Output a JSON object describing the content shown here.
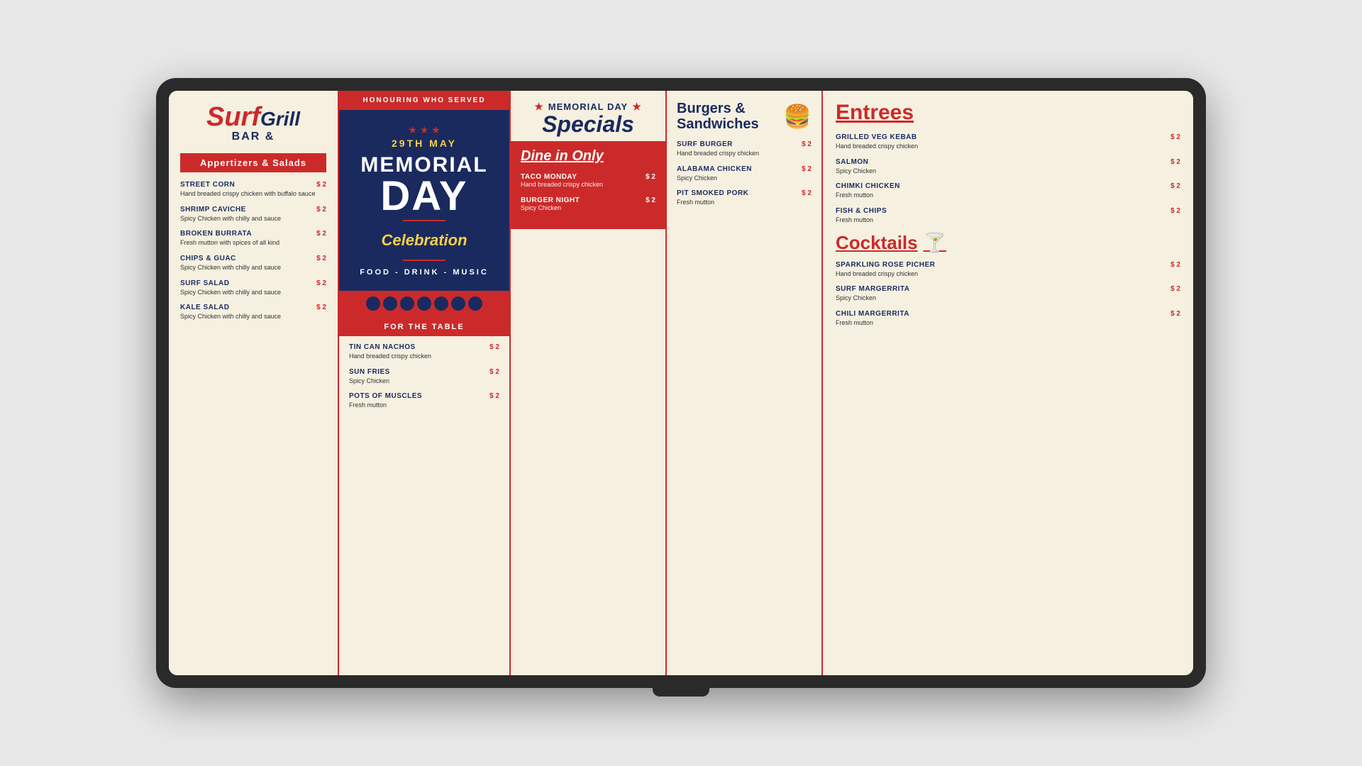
{
  "tv": {
    "logo": {
      "surf": "Surf",
      "bar_and": "BAR &",
      "grill": "Grill"
    },
    "appetizers": {
      "header": "Appertizers & Salads",
      "items": [
        {
          "name": "STREET CORN",
          "price": "$ 2",
          "desc": "Hand breaded crispy chicken with buffalo sauce"
        },
        {
          "name": "SHRIMP CAVICHE",
          "price": "$ 2",
          "desc": "Spicy Chicken with chilly and sauce"
        },
        {
          "name": "BROKEN BURRATA",
          "price": "$ 2",
          "desc": "Fresh mutton with spices of all kind"
        },
        {
          "name": "CHIPS & GUAC",
          "price": "$ 2",
          "desc": "Spicy Chicken with chilly and sauce"
        },
        {
          "name": "SURF SALAD",
          "price": "$ 2",
          "desc": "Spicy Chicken with chilly and sauce"
        },
        {
          "name": "KALE SALAD",
          "price": "$ 2",
          "desc": "Spicy Chicken with chilly and sauce"
        }
      ]
    },
    "banner": {
      "honouring": "HONOURING WHO SERVED",
      "date": "29TH MAY",
      "memorial": "MEMORIAL",
      "day": "DAY",
      "celebration": "Celebration",
      "food": "FOOD - DRINK - MUSIC",
      "stars": "★ ★ ★"
    },
    "for_the_table": {
      "header": "FOR THE TABLE",
      "items": [
        {
          "name": "TIN CAN NACHOS",
          "price": "$ 2",
          "desc": "Hand breaded crispy chicken"
        },
        {
          "name": "SUN FRIES",
          "price": "$ 2",
          "desc": "Spicy Chicken"
        },
        {
          "name": "POTS OF MUSCLES",
          "price": "$ 2",
          "desc": "Fresh mutton"
        }
      ]
    },
    "specials": {
      "star_title": "MEMORIAL DAY",
      "script": "Specials",
      "dine_in": "Dine in Only",
      "items": [
        {
          "name": "TACO MONDAY",
          "price": "$ 2",
          "desc": "Hand breaded crispy chicken"
        },
        {
          "name": "BURGER NIGHT",
          "price": "$ 2",
          "desc": "Spicy Chicken"
        }
      ]
    },
    "burgers": {
      "title": "Burgers & Sandwiches",
      "icon": "🍔",
      "items": [
        {
          "name": "SURF BURGER",
          "price": "$ 2",
          "desc": "Hand breaded crispy chicken"
        },
        {
          "name": "ALABAMA CHICKEN",
          "price": "$ 2",
          "desc": "Spicy Chicken"
        },
        {
          "name": "PIT SMOKED PORK",
          "price": "$ 2",
          "desc": "Fresh mutton"
        }
      ]
    },
    "entrees": {
      "title": "Entrees",
      "items": [
        {
          "name": "GRILLED VEG KEBAB",
          "price": "$ 2",
          "desc": "Hand breaded crispy chicken"
        },
        {
          "name": "SALMON",
          "price": "$ 2",
          "desc": "Spicy Chicken"
        },
        {
          "name": "CHIMKI CHICKEN",
          "price": "$ 2",
          "desc": "Fresh mutton"
        },
        {
          "name": "FISH & CHIPS",
          "price": "$ 2",
          "desc": "Fresh mutton"
        }
      ]
    },
    "cocktails": {
      "title": "Cocktails",
      "icon": "🍸",
      "items": [
        {
          "name": "SPARKLING ROSE PICHER",
          "price": "$ 2",
          "desc": "Hand breaded crispy chicken"
        },
        {
          "name": "SURF MARGERRITA",
          "price": "$ 2",
          "desc": "Spicy Chicken"
        },
        {
          "name": "CHILI MARGERRITA",
          "price": "$ 2",
          "desc": "Fresh mutton"
        }
      ]
    }
  }
}
